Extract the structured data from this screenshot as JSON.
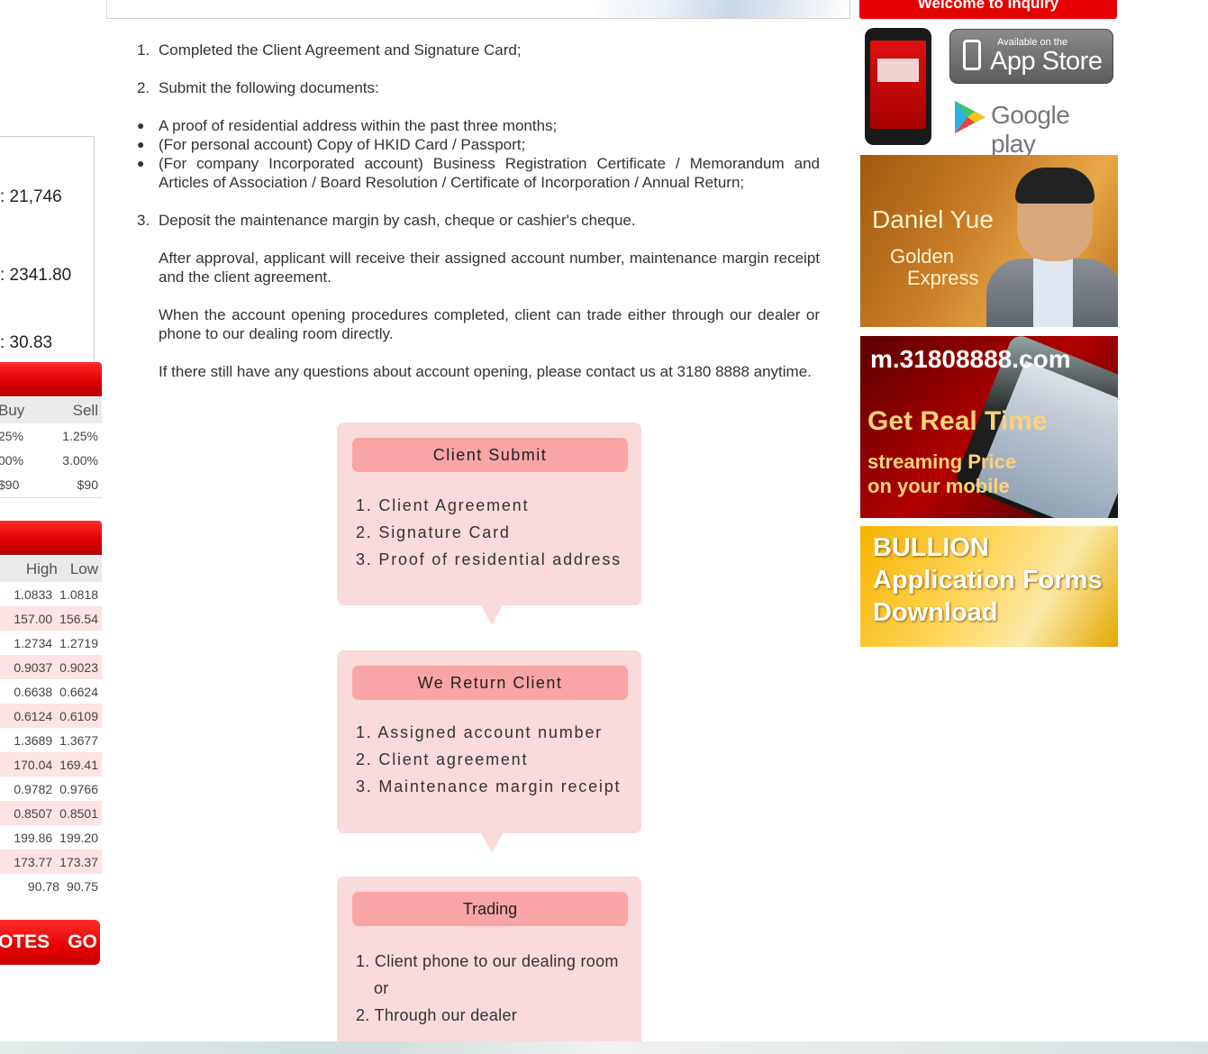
{
  "sidebar": {
    "index_values": [
      ": 21,746",
      ": 2341.80",
      ": 30.83"
    ],
    "fees_table": {
      "headers": [
        "Buy",
        "Sell"
      ],
      "rows": [
        [
          "25%",
          "1.25%"
        ],
        [
          "00%",
          "3.00%"
        ],
        [
          "$90",
          "$90"
        ]
      ]
    },
    "rates_table": {
      "headers": [
        "High",
        "Low"
      ],
      "rows": [
        [
          "1.0833",
          "1.0818"
        ],
        [
          "157.00",
          "156.54"
        ],
        [
          "1.2734",
          "1.2719"
        ],
        [
          "0.9037",
          "0.9023"
        ],
        [
          "0.6638",
          "0.6624"
        ],
        [
          "0.6124",
          "0.6109"
        ],
        [
          "1.3689",
          "1.3677"
        ],
        [
          "170.04",
          "169.41"
        ],
        [
          "0.9782",
          "0.9766"
        ],
        [
          "0.8507",
          "0.8501"
        ],
        [
          "199.86",
          "199.20"
        ],
        [
          "173.77",
          "173.37"
        ],
        [
          "90.78",
          "90.75"
        ]
      ]
    },
    "quotes_label": "OTES",
    "go_label": "GO"
  },
  "header": {
    "welcome_label": "Welcome to Inquiry"
  },
  "content": {
    "step1": {
      "num": "1.",
      "text": "Completed the Client Agreement and Signature Card;"
    },
    "step2": {
      "num": "2.",
      "text": "Submit the following documents:"
    },
    "documents": [
      "A proof of residential address within the past three months;",
      "(For personal account) Copy of HKID Card / Passport;",
      "(For company Incorporated account) Business Registration Certificate / Memorandum and Articles of Association / Board Resolution / Certificate of Incorporation / Annual Return;"
    ],
    "step3": {
      "num": "3.",
      "text": "Deposit the maintenance margin by cash, cheque or cashier's cheque."
    },
    "para_approval": "After approval, applicant will receive their assigned account number, maintenance margin receipt and the client agreement.",
    "para_trade": "When the account opening procedures completed, client can trade either through our dealer or phone to our dealing room directly.",
    "para_contact": "If there still have any questions about account opening, please contact us at 3180 8888 anytime."
  },
  "flow": [
    {
      "title": "Client Submit",
      "items": [
        "1. Client Agreement",
        "2. Signature Card",
        "3. Proof of residential address"
      ]
    },
    {
      "title": "We Return Client",
      "items": [
        "1. Assigned account number",
        "2. Client agreement",
        "3. Maintenance margin receipt"
      ]
    },
    {
      "title": "Trading",
      "items": [
        "1. Client phone to our dealing room",
        "or",
        "2. Through our dealer"
      ]
    }
  ],
  "right": {
    "appstore_small": "Available on the",
    "appstore_big": "App Store",
    "googleplay": "Google play",
    "daniel_name": "Daniel Yue",
    "daniel_line1": "Golden",
    "daniel_line2": "Express",
    "mobile_url": "m.31808888.com",
    "mobile_line1": "Get Real Time",
    "mobile_line2": "streaming Price",
    "mobile_line3": "on your mobile",
    "bullion_line1": "BULLION",
    "bullion_line2": "Application Forms",
    "bullion_line3": "Download"
  }
}
